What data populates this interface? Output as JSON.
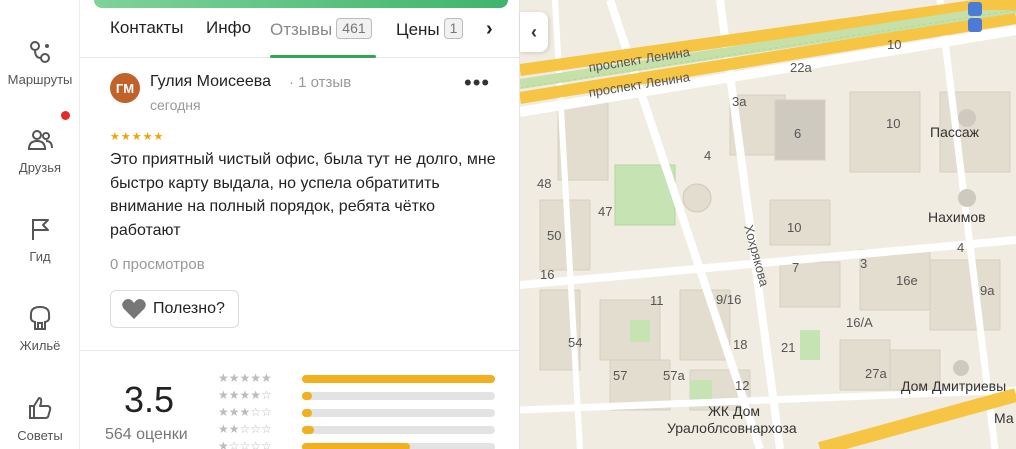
{
  "rail": {
    "items": [
      {
        "label": "Маршруты",
        "icon": "routes-icon"
      },
      {
        "label": "Друзья",
        "icon": "friends-icon"
      },
      {
        "label": "Гид",
        "icon": "guide-flag-icon"
      },
      {
        "label": "Жильё",
        "icon": "housing-icon"
      },
      {
        "label": "Советы",
        "icon": "thumbs-up-icon"
      }
    ]
  },
  "tabs": [
    {
      "label": "Контакты"
    },
    {
      "label": "Инфо"
    },
    {
      "label": "Отзывы",
      "badge": "461"
    },
    {
      "label": "Цены",
      "badge": "1"
    }
  ],
  "review": {
    "avatar_initials": "ГМ",
    "avatar_color": "#c0622a",
    "author": "Гулия Моисеева",
    "meta": "· 1 отзыв",
    "date": "сегодня",
    "stars": "★★★★★",
    "text": "Это приятный чистый офис, была тут не долго, мне быстро карту выдала, но успела обратитить внимание на полный порядок, ребята чётко работают",
    "views": "0 просмотров",
    "helpful_label": "Полезно?"
  },
  "rating": {
    "value": "3.5",
    "count": "564 оценки",
    "bars": [
      {
        "stars": "★★★★★",
        "fraction": 1.0
      },
      {
        "stars": "★★★★",
        "fraction": 0.05
      },
      {
        "stars": "★★★",
        "fraction": 0.05
      },
      {
        "stars": "★★",
        "fraction": 0.06
      },
      {
        "stars": "★",
        "fraction": 0.56
      }
    ],
    "accent": "#f2b01e"
  },
  "map": {
    "street_labels": [
      "проспект Ленина",
      "проспект Ленина",
      "Хохрякова"
    ],
    "building_numbers": [
      "22a",
      "10",
      "3a",
      "6",
      "10",
      "4",
      "48",
      "47",
      "50",
      "4",
      "10",
      "16",
      "7",
      "3",
      "16e",
      "9a",
      "11",
      "9/16",
      "16/A",
      "54",
      "18",
      "21",
      "27a",
      "57",
      "57a",
      "12"
    ],
    "poi": [
      "Пассаж",
      "Нахимов",
      "Дом Дмитриевы",
      "ЖК Дом",
      "Уралоблсовнархоза"
    ],
    "partial": "Ма"
  },
  "colors": {
    "main_road": "#f6c544",
    "tab_active_underline": "#2fa84f",
    "map_background": "#f0ece1"
  }
}
